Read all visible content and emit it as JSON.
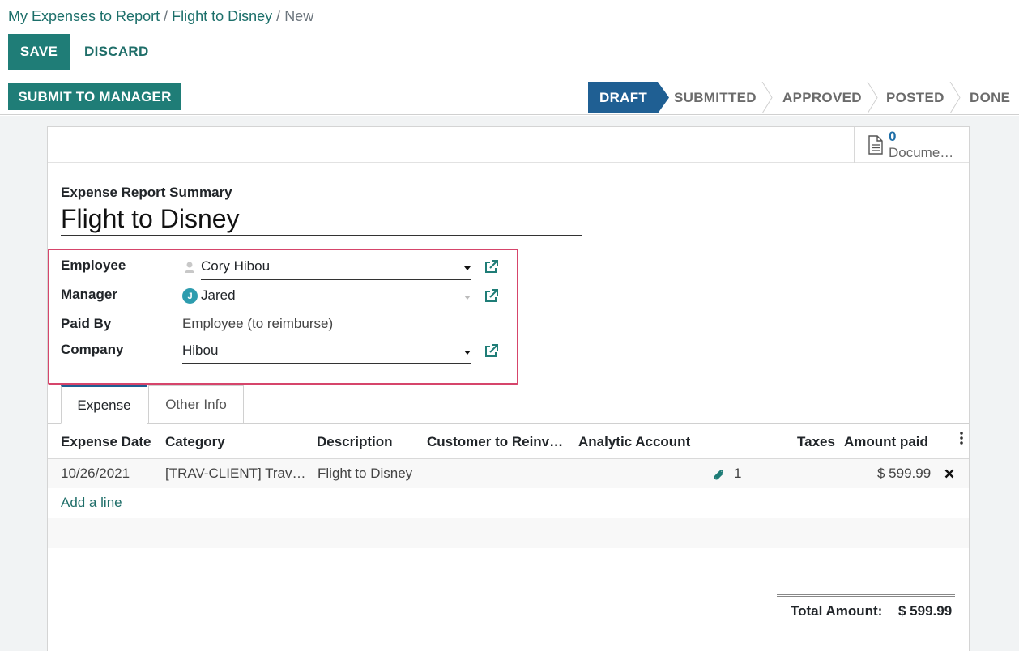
{
  "breadcrumb": {
    "item1": "My Expenses to Report",
    "sep1": " / ",
    "item2": "Flight to Disney",
    "sep2": " / ",
    "current": "New"
  },
  "toolbar": {
    "save_label": "SAVE",
    "discard_label": "DISCARD"
  },
  "statusbar": {
    "submit_label": "SUBMIT TO MANAGER",
    "stages": [
      "DRAFT",
      "SUBMITTED",
      "APPROVED",
      "POSTED",
      "DONE"
    ],
    "active_stage": "DRAFT"
  },
  "smart_button": {
    "count": "0",
    "label": "Docume…"
  },
  "form": {
    "summary_label": "Expense Report Summary",
    "title": "Flight to Disney",
    "employee_label": "Employee",
    "employee_value": "Cory Hibou",
    "manager_label": "Manager",
    "manager_value": "Jared",
    "manager_avatar_letter": "J",
    "paid_by_label": "Paid By",
    "paid_by_value": "Employee (to reimburse)",
    "company_label": "Company",
    "company_value": "Hibou"
  },
  "tabs": [
    "Expense",
    "Other Info"
  ],
  "table": {
    "columns": [
      "Expense Date",
      "Category",
      "Description",
      "Customer to Reinv…",
      "Analytic Account",
      "Taxes",
      "Amount paid"
    ],
    "rows": [
      {
        "date": "10/26/2021",
        "category": "[TRAV-CLIENT] Trav…",
        "description": "Flight to Disney",
        "attachments": "1",
        "amount": "$ 599.99"
      }
    ],
    "add_line": "Add a line"
  },
  "totals": {
    "label": "Total Amount:",
    "value": "$ 599.99"
  },
  "colors": {
    "primary": "#1f7d77",
    "active_stage": "#1f5f93",
    "highlight": "#d6456b",
    "link": "#1f6e69"
  }
}
